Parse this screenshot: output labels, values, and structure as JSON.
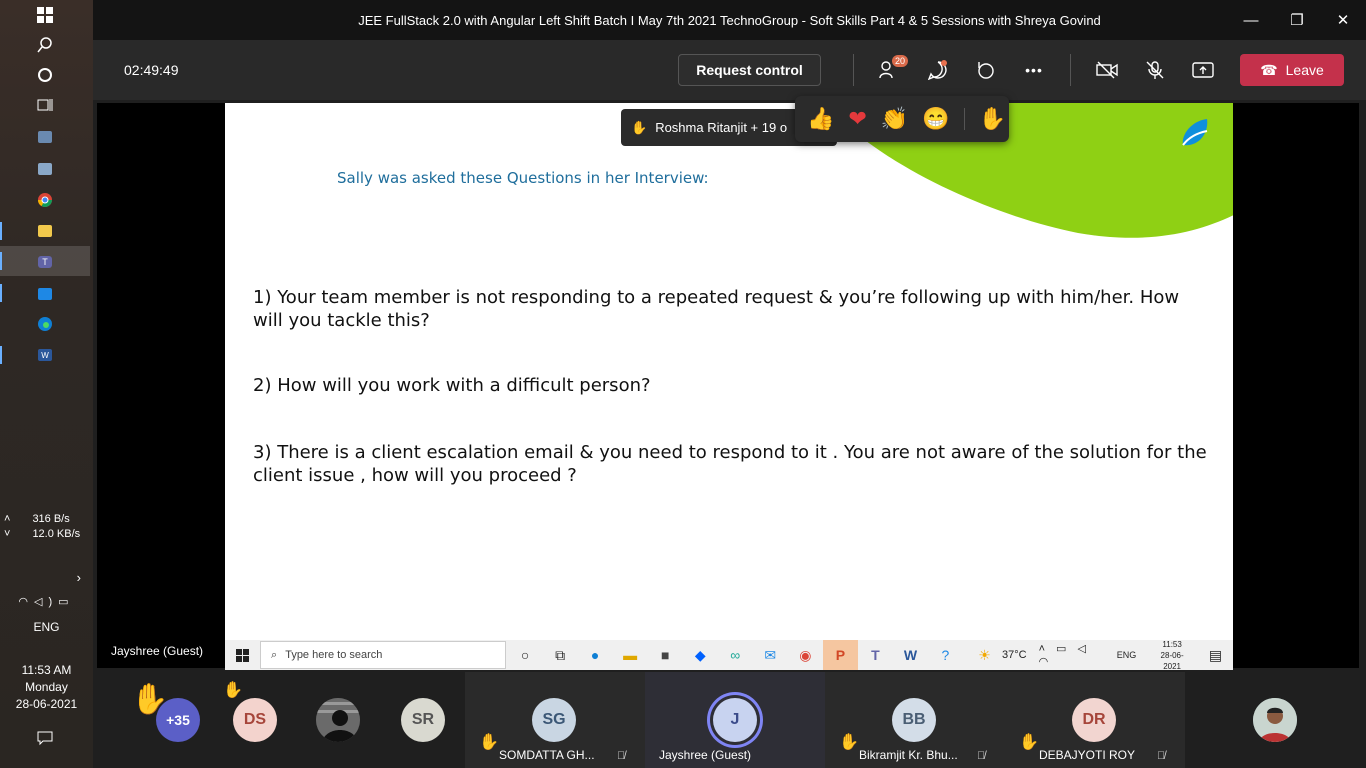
{
  "window": {
    "title": "JEE FullStack 2.0 with Angular Left Shift Batch I May 7th 2021 TechnoGroup - Soft Skills Part 4 & 5 Sessions with Shreya Govind"
  },
  "toolbar": {
    "timer": "02:49:49",
    "request_control": "Request control",
    "participants_badge": "20",
    "leave": "Leave",
    "more": "•••"
  },
  "slide": {
    "heading": "Sally was asked these Questions in her Interview:",
    "q1": "1) Your team member is not responding to a repeated request & you’re following up with him/her. How will you tackle this?",
    "q2": "2) How will you work with a difficult person?",
    "q3": "3) There is a client escalation email & you need to respond to it . You are not aware of the solution for the client issue , how will you proceed ?"
  },
  "shared_taskbar": {
    "search_placeholder": "Type here to search",
    "temp": "37°C",
    "lang": "ENG",
    "time": "11:53",
    "date": "28-06-2021"
  },
  "presenter": "Jayshree (Guest)",
  "raise_hand_tip": "Roshma Ritanjit + 19 o",
  "reactions": [
    "like",
    "heart",
    "clap",
    "laugh",
    "raise-hand"
  ],
  "sys": {
    "net_up": "316 B/s",
    "net_down": "12.0 KB/s",
    "lang": "ENG",
    "time": "11:53 AM",
    "day": "Monday",
    "date": "28-06-2021"
  },
  "gallery": {
    "overflow": "+35",
    "tiles": [
      {
        "initials": "DS",
        "color": "#f3d3cd"
      },
      {
        "initials": "SR",
        "color": "#d9d9d0"
      },
      {
        "initials": "SG",
        "color": "#c9d6e3",
        "name": "SOMDATTA GH..."
      },
      {
        "initials": "J",
        "color": "#c8d3f0",
        "name": "Jayshree (Guest)"
      },
      {
        "initials": "BB",
        "color": "#d3dde8",
        "name": "Bikramjit Kr. Bhu..."
      },
      {
        "initials": "DR",
        "color": "#f2d5d0",
        "name": "DEBAJYOTI ROY"
      }
    ]
  }
}
